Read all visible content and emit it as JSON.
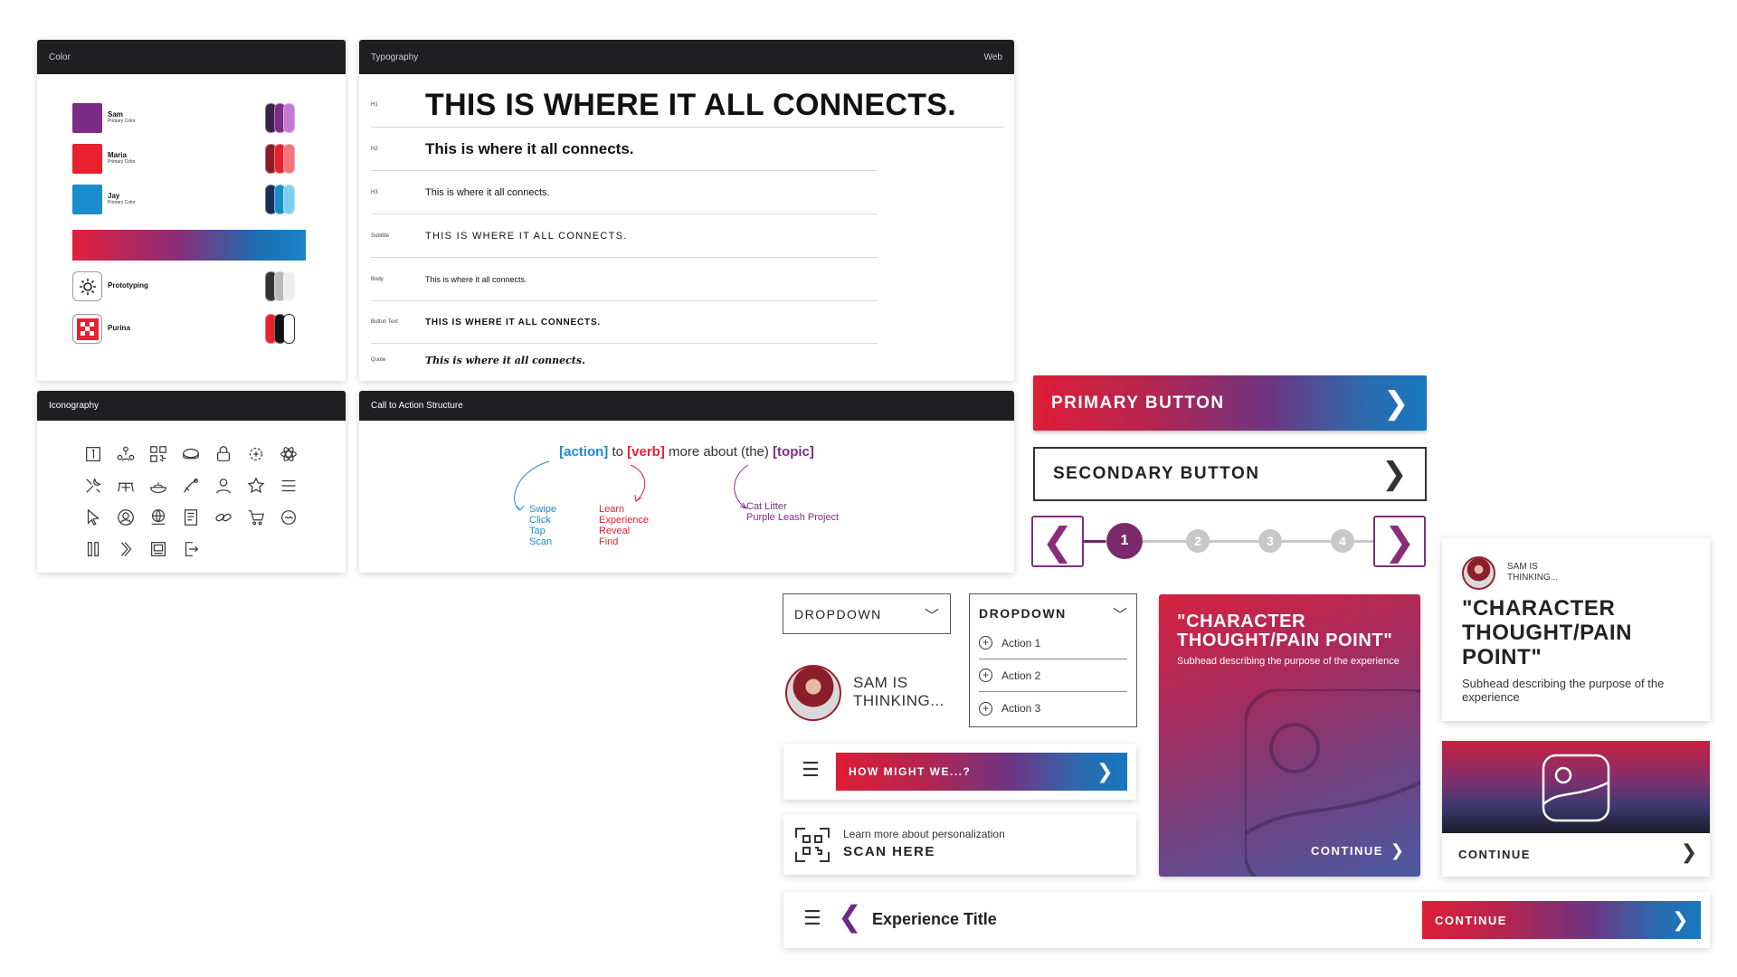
{
  "color_panel": {
    "title": "Color",
    "swatches": [
      {
        "name": "Sam",
        "sub": "Primary Color",
        "color": "#7b2d85",
        "pills": [
          "#3c1f4b",
          "#7b2d85",
          "#c07ad0"
        ]
      },
      {
        "name": "Maria",
        "sub": "Primary Color",
        "color": "#e8202f",
        "pills": [
          "#8c1c25",
          "#e8202f",
          "#f6747c"
        ]
      },
      {
        "name": "Jay",
        "sub": "Primary Color",
        "color": "#1a8ccc",
        "pills": [
          "#1a2f55",
          "#1a8ccc",
          "#7ecfee"
        ]
      }
    ],
    "brands": [
      {
        "name": "Prototyping",
        "icon": "gear-wrench-icon",
        "pills": [
          "#333333",
          "#bbbbbb",
          "#eeeeee"
        ]
      },
      {
        "name": "Purina",
        "icon": "purina-checkerboard-icon",
        "pills": [
          "#e8202f",
          "#111111",
          "#ffffff"
        ]
      }
    ]
  },
  "typography_panel": {
    "title": "Typography",
    "platform": "Web",
    "rows": [
      {
        "label": "H1",
        "text": "THIS IS WHERE IT ALL CONNECTS."
      },
      {
        "label": "H2",
        "text": "This is where it all connects."
      },
      {
        "label": "H3",
        "text": "This is where it all connects."
      },
      {
        "label": "Subtitle",
        "text": "THIS IS WHERE IT ALL CONNECTS."
      },
      {
        "label": "Body",
        "text": "This is where it all connects."
      },
      {
        "label": "Button Text",
        "text": "THIS IS WHERE IT ALL CONNECTS."
      },
      {
        "label": "Quote",
        "text": "This is where it all connects."
      }
    ]
  },
  "icon_panel": {
    "title": "Iconography",
    "icons": [
      "number-one-icon",
      "people-network-icon",
      "qr-code-icon",
      "pet-bed-icon",
      "lock-icon",
      "sparkle-gear-icon",
      "atom-icon",
      "tools-icon",
      "picnic-table-icon",
      "food-bowl-icon",
      "leash-icon",
      "person-icon",
      "star-icon",
      "menu-icon",
      "cursor-icon",
      "user-circle-icon",
      "globe-cart-icon",
      "document-icon",
      "link-icon",
      "cart-icon",
      "signature-icon",
      "pause-icon",
      "double-chevron-icon",
      "gallery-icon",
      "exit-icon"
    ]
  },
  "cta_panel": {
    "title": "Call to Action Structure",
    "action": "[action]",
    "to": "to",
    "verb": "[verb]",
    "more": "more about (the)",
    "topic": "[topic]",
    "actions": [
      "Swipe",
      "Click",
      "Tap",
      "Scan"
    ],
    "verbs": [
      "Learn",
      "Experience",
      "Reveal",
      "Find"
    ],
    "topics": [
      "Cat Litter",
      "Purple Leash Project"
    ],
    "colors": {
      "action": "#1a8ccc",
      "verb": "#e8202f",
      "topic": "#7b2d85"
    }
  },
  "buttons": {
    "primary": "PRIMARY BUTTON",
    "secondary": "SECONDARY BUTTON"
  },
  "stepper": {
    "steps": [
      "1",
      "2",
      "3",
      "4"
    ],
    "active": "1"
  },
  "dropdown_closed": {
    "label": "DROPDOWN"
  },
  "dropdown_open": {
    "label": "DROPDOWN",
    "items": [
      "Action 1",
      "Action 2",
      "Action 3"
    ]
  },
  "thinking_small": {
    "text": "SAM IS THINKING..."
  },
  "how_bar": {
    "label": "HOW MIGHT WE...?"
  },
  "scan_card": {
    "sub": "Learn more about personalization",
    "main": "SCAN HERE"
  },
  "gradient_card": {
    "title": "\"CHARACTER THOUGHT/PAIN POINT\"",
    "sub": "Subhead describing the purpose of the experience",
    "cta": "CONTINUE"
  },
  "thought_card": {
    "who": "SAM IS THINKING...",
    "title": "\"CHARACTER THOUGHT/PAIN POINT\"",
    "sub": "Subhead describing the purpose of the experience"
  },
  "image_card": {
    "cta": "CONTINUE"
  },
  "experience_bar": {
    "title": "Experience Title",
    "cta": "CONTINUE"
  }
}
